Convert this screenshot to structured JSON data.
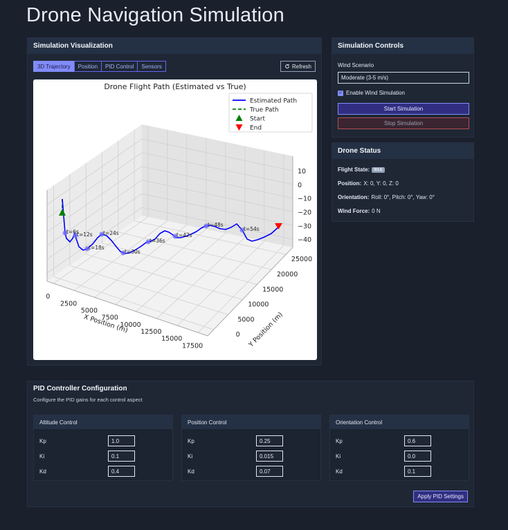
{
  "page": {
    "title": "Drone Navigation Simulation"
  },
  "viz": {
    "title": "Simulation Visualization",
    "tabs": [
      {
        "label": "3D Trajectory",
        "active": true
      },
      {
        "label": "Position",
        "active": false
      },
      {
        "label": "PID Control",
        "active": false
      },
      {
        "label": "Sensors",
        "active": false
      }
    ],
    "refresh_icon": "refresh-icon",
    "refresh_label": "Refresh"
  },
  "controls": {
    "title": "Simulation Controls",
    "wind_label": "Wind Scenario",
    "wind_value": "Moderate (3-5 m/s)",
    "wind_enabled": true,
    "wind_checkbox_label": "Enable Wind Simulation",
    "start_label": "Start Simulation",
    "stop_label": "Stop Simulation"
  },
  "status": {
    "title": "Drone Status",
    "flight_state_label": "Flight State:",
    "flight_state_value": "IDLE",
    "position_label": "Position:",
    "position_value": "X: 0, Y: 0, Z: 0",
    "orientation_label": "Orientation:",
    "orientation_value": "Roll: 0°, Pitch: 0°, Yaw: 0°",
    "wind_force_label": "Wind Force:",
    "wind_force_value": "0 N"
  },
  "pid": {
    "title": "PID Controller Configuration",
    "subtitle": "Configure the PID gains for each control aspect",
    "groups": [
      {
        "title": "Altitude Control",
        "kp": "1.0",
        "ki": "0.1",
        "kd": "0.4"
      },
      {
        "title": "Position Control",
        "kp": "0.25",
        "ki": "0.015",
        "kd": "0.07"
      },
      {
        "title": "Orientation Control",
        "kp": "0.6",
        "ki": "0.0",
        "kd": "0.1"
      }
    ],
    "kp_label": "Kp",
    "ki_label": "Ki",
    "kd_label": "Kd",
    "apply_label": "Apply PID Settings"
  },
  "chart_data": {
    "type": "line",
    "title": "Drone Flight Path (Estimated vs True)",
    "xlabel": "X Position (m)",
    "ylabel": "Y Position (m)",
    "zlabel": "",
    "x_ticks": [
      "0",
      "2500",
      "5000",
      "7500",
      "10000",
      "12500",
      "15000",
      "17500"
    ],
    "y_ticks": [
      "0",
      "5000",
      "10000",
      "15000",
      "20000",
      "25000"
    ],
    "z_ticks": [
      "10",
      "0",
      "−10",
      "−20",
      "−30",
      "−40"
    ],
    "xlim": [
      0,
      17500
    ],
    "ylim": [
      0,
      25000
    ],
    "zlim": [
      -45,
      12
    ],
    "legend": [
      "Estimated Path",
      "True Path",
      "Start",
      "End"
    ],
    "legend_position": "top-right",
    "time_labels": [
      "t=6s",
      "t=12s",
      "t=18s",
      "t=24s",
      "t=30s",
      "t=36s",
      "t=42s",
      "t=48s",
      "t=54s"
    ],
    "colors": {
      "estimated": "#0000ff",
      "true": "#008000",
      "start": "#008000",
      "end": "#ff0000"
    },
    "grid": true
  }
}
